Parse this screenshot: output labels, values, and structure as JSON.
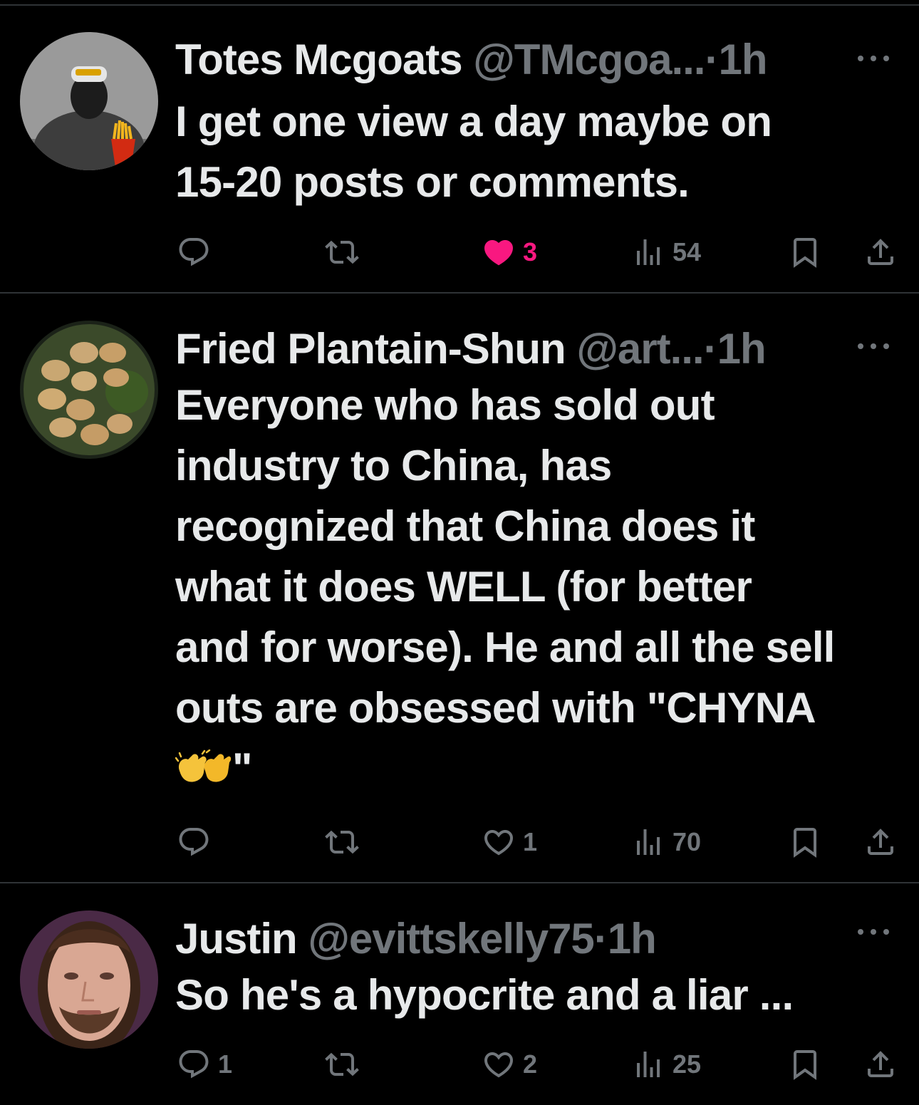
{
  "tweets": [
    {
      "name": "Totes Mcgoats",
      "handle": "@TMcgoa...",
      "dot": "·",
      "time": "1h",
      "lines": [
        "I get one view a day maybe on",
        "15-20 posts or comments."
      ],
      "reply_count": "",
      "retweet_count": "",
      "like_count": "3",
      "liked": true,
      "view_count": "54"
    },
    {
      "name": "Fried Plantain-Shun",
      "handle": "@art...",
      "dot": "·",
      "time": "1h",
      "lines": [
        "Everyone who has sold out",
        "industry to China, has",
        "recognized that China does it",
        "what it does WELL (for better",
        "and for worse). He and all the sell",
        "outs are obsessed with \"CHYNA"
      ],
      "last_line_suffix": "\"",
      "last_line_emoji": "clapping-hands",
      "reply_count": "",
      "retweet_count": "",
      "like_count": "1",
      "liked": false,
      "view_count": "70"
    },
    {
      "name": "Justin",
      "handle": "@evittskelly75",
      "dot": "·",
      "time": "1h",
      "lines": [
        "So he's a hypocrite and a liar ..."
      ],
      "reply_count": "1",
      "retweet_count": "",
      "like_count": "2",
      "liked": false,
      "view_count": "25"
    }
  ],
  "colors": {
    "background": "#000000",
    "text": "#e7e9ea",
    "muted": "#71767b",
    "like": "#f91880",
    "divider": "#2f3336"
  },
  "icons": [
    "reply-icon",
    "retweet-icon",
    "like-icon",
    "views-icon",
    "bookmark-icon",
    "share-icon",
    "more-icon"
  ]
}
